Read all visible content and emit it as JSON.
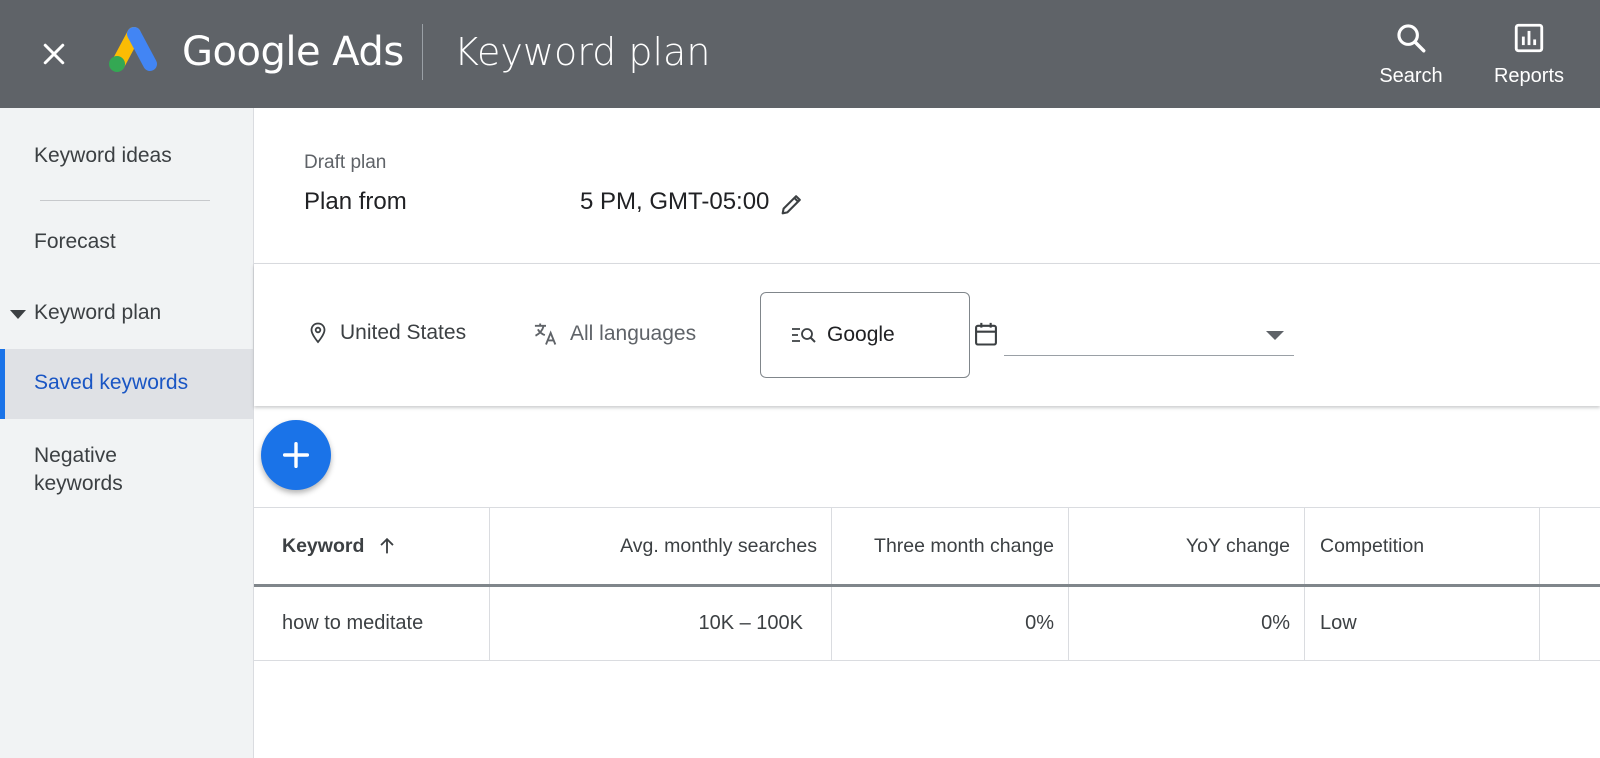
{
  "topbar": {
    "brand": "Google Ads",
    "title": "Keyword plan",
    "actions": [
      {
        "label": "Search",
        "icon": "search-icon"
      },
      {
        "label": "Reports",
        "icon": "reports-icon"
      }
    ]
  },
  "sidebar": {
    "items": [
      {
        "label": "Keyword ideas"
      },
      {
        "label": "Forecast"
      },
      {
        "label": "Keyword plan"
      },
      {
        "label": "Saved keywords"
      },
      {
        "label": "Negative keywords"
      }
    ]
  },
  "plan": {
    "subtitle": "Draft plan",
    "name": "Plan from",
    "time": "5 PM, GMT-05:00"
  },
  "filters": {
    "location": "United States",
    "language": "All languages",
    "network": "Google"
  },
  "table": {
    "headers": [
      "Keyword",
      "Avg. monthly searches",
      "Three month change",
      "YoY change",
      "Competition"
    ],
    "rows": [
      [
        "how to meditate",
        "10K – 100K",
        "0%",
        "0%",
        "Low"
      ]
    ]
  },
  "colors": {
    "topbar": "#5f6368",
    "accent": "#1a73e8",
    "active_text": "#1a56c4",
    "sidebar_bg": "#f1f3f4"
  }
}
